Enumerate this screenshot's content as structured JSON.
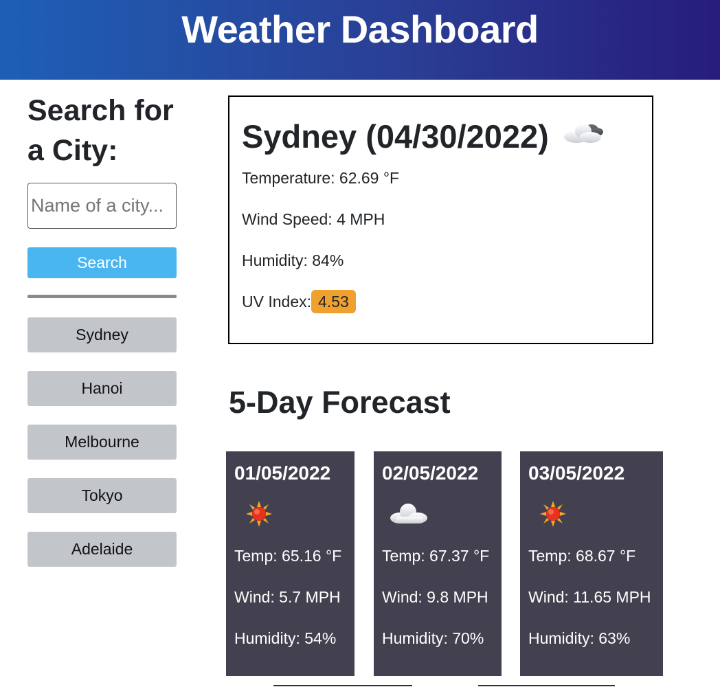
{
  "header": {
    "title": "Weather Dashboard"
  },
  "sidebar": {
    "heading": "Search for a City:",
    "search_placeholder": "Name of a city...",
    "search_label": "Search",
    "history": [
      "Sydney",
      "Hanoi",
      "Melbourne",
      "Tokyo",
      "Adelaide"
    ]
  },
  "current": {
    "title": "Sydney (04/30/2022)",
    "icon": "cloudy-icon",
    "temperature": "Temperature: 62.69 °F",
    "wind": "Wind Speed: 4 MPH",
    "humidity": "Humidity: 84%",
    "uv_label": "UV Index:",
    "uv_value": "4.53",
    "uv_color": "#f0a02e"
  },
  "forecast": {
    "title": "5-Day Forecast",
    "days": [
      {
        "date": "01/05/2022",
        "icon": "sun-icon",
        "temp": "Temp: 65.16 °F",
        "wind": "Wind: 5.7 MPH",
        "humidity": "Humidity: 54%"
      },
      {
        "date": "02/05/2022",
        "icon": "cloud-icon",
        "temp": "Temp: 67.37 °F",
        "wind": "Wind: 9.8 MPH",
        "humidity": "Humidity: 70%"
      },
      {
        "date": "03/05/2022",
        "icon": "sun-icon",
        "temp": "Temp: 68.67 °F",
        "wind": "Wind: 11.65 MPH",
        "humidity": "Humidity: 63%"
      }
    ]
  },
  "colors": {
    "header_start": "#1e5fb6",
    "header_end": "#271c7c",
    "search_button": "#4ab6f0",
    "history_button": "#c2c6ca",
    "card_bg": "#43414f"
  }
}
